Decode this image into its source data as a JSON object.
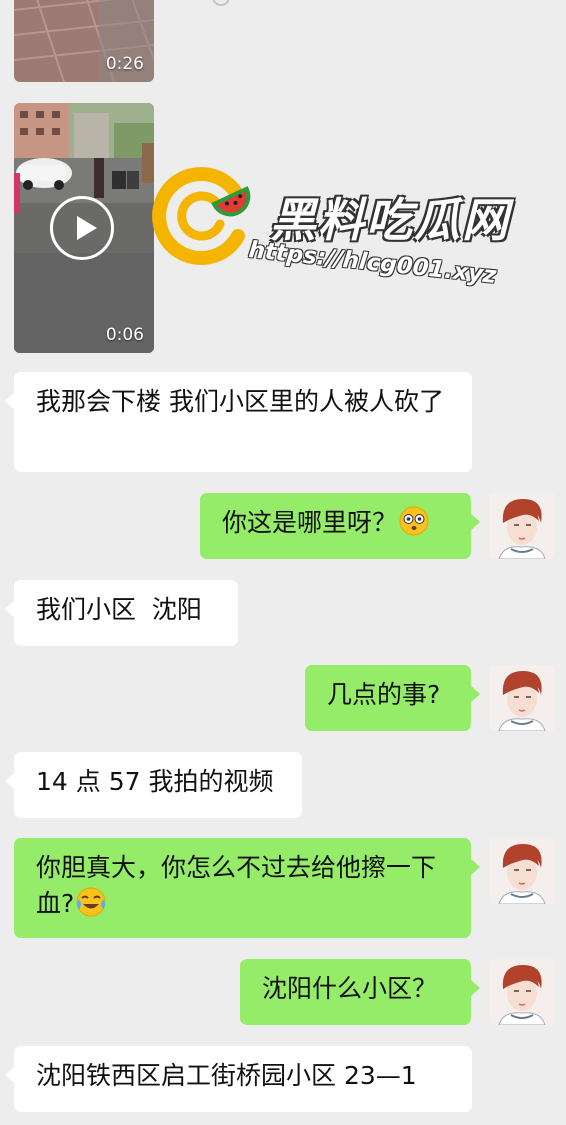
{
  "header": {
    "title": ""
  },
  "messages": [
    {
      "id": "video1",
      "type": "video",
      "duration": "0:26"
    },
    {
      "id": "video2",
      "type": "video",
      "duration": "0:06"
    },
    {
      "id": "m1",
      "side": "in",
      "text": "我那会下楼 我们小区里的人被人砍了"
    },
    {
      "id": "m2",
      "side": "out",
      "text": "你这是哪里呀？",
      "emoji": "flushed-face"
    },
    {
      "id": "m3",
      "side": "in",
      "text": "我们小区  沈阳"
    },
    {
      "id": "m4",
      "side": "out",
      "text": "几点的事?"
    },
    {
      "id": "m5",
      "side": "in",
      "text": "14 点 57 我拍的视频"
    },
    {
      "id": "m6",
      "side": "out",
      "text": "你胆真大，你怎么不过去给他擦一下血?",
      "emoji": "tears-of-joy"
    },
    {
      "id": "m7",
      "side": "out",
      "text": "沈阳什么小区？"
    },
    {
      "id": "m8",
      "side": "in",
      "text": "沈阳铁西区启工街桥园小区 23—1"
    }
  ],
  "watermark": {
    "title": "黑料吃瓜网",
    "url": "https://hlcg001.xyz"
  },
  "colors": {
    "background": "#ededed",
    "incoming_bubble": "#ffffff",
    "outgoing_bubble": "#95ec69",
    "logo_orange": "#f5b400",
    "logo_red": "#e53935",
    "logo_green": "#2e9b3a"
  }
}
